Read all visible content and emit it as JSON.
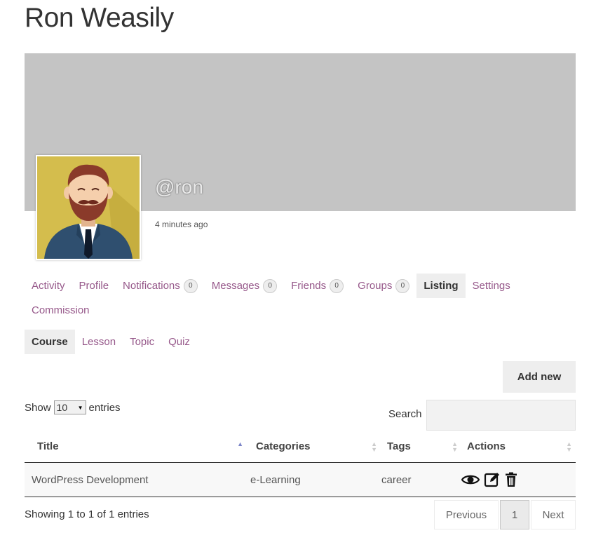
{
  "page": {
    "title": "Ron Weasily"
  },
  "profile": {
    "handle": "@ron",
    "last_active": "4 minutes ago"
  },
  "nav": [
    {
      "label": "Activity",
      "count": null,
      "active": false
    },
    {
      "label": "Profile",
      "count": null,
      "active": false
    },
    {
      "label": "Notifications",
      "count": "0",
      "active": false
    },
    {
      "label": "Messages",
      "count": "0",
      "active": false
    },
    {
      "label": "Friends",
      "count": "0",
      "active": false
    },
    {
      "label": "Groups",
      "count": "0",
      "active": false
    },
    {
      "label": "Listing",
      "count": null,
      "active": true
    },
    {
      "label": "Settings",
      "count": null,
      "active": false
    },
    {
      "label": "Commission",
      "count": null,
      "active": false
    }
  ],
  "subnav": [
    {
      "label": "Course",
      "active": true
    },
    {
      "label": "Lesson",
      "active": false
    },
    {
      "label": "Topic",
      "active": false
    },
    {
      "label": "Quiz",
      "active": false
    }
  ],
  "toolbar": {
    "add_new_label": "Add new"
  },
  "table_controls": {
    "show_label": "Show",
    "entries_value": "10",
    "entries_label": "entries",
    "search_label": "Search"
  },
  "table": {
    "columns": [
      "Title",
      "Categories",
      "Tags",
      "Actions"
    ],
    "rows": [
      {
        "title": "WordPress Development",
        "category": "e-Learning",
        "tags": "career"
      }
    ]
  },
  "footer": {
    "info": "Showing 1 to 1 of 1 entries",
    "previous_label": "Previous",
    "current_page": "1",
    "next_label": "Next"
  },
  "colors": {
    "link": "#96588a",
    "cover": "#c4c4c4",
    "active_tab_bg": "#eeeeee"
  },
  "icons": [
    "view-icon",
    "edit-icon",
    "trash-icon"
  ]
}
